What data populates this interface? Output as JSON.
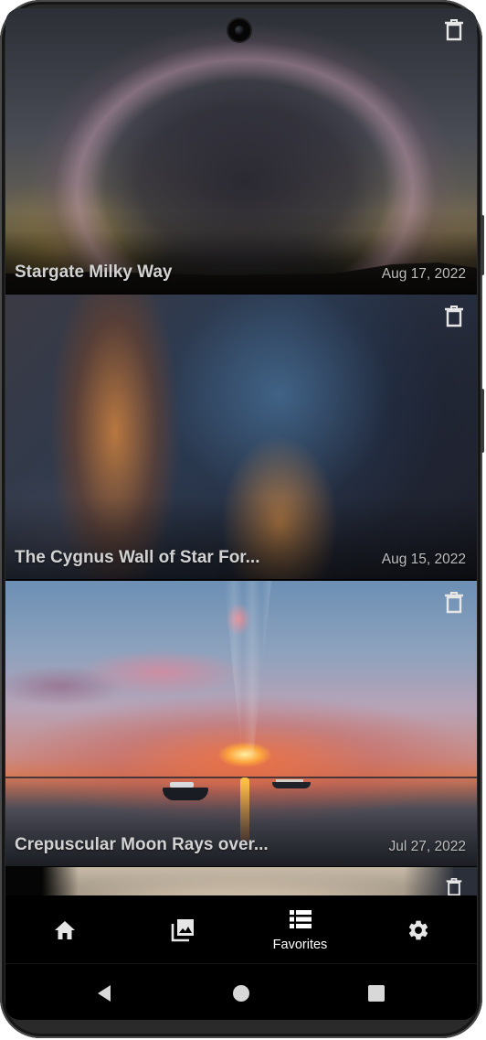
{
  "cards": [
    {
      "title": "Stargate Milky Way",
      "date": "Aug 17, 2022",
      "image": "milky-way-arch-photo"
    },
    {
      "title": "The Cygnus Wall of Star For...",
      "date": "Aug 15, 2022",
      "image": "cygnus-wall-nebula-photo"
    },
    {
      "title": "Crepuscular Moon Rays over...",
      "date": "Jul 27, 2022",
      "image": "moon-rays-sea-boats-photo"
    },
    {
      "title": "",
      "date": "",
      "image": "partial-card-photo"
    }
  ],
  "bottom_nav": {
    "items": [
      {
        "icon": "home-icon",
        "label": ""
      },
      {
        "icon": "gallery-icon",
        "label": ""
      },
      {
        "icon": "favorites-list-icon",
        "label": "Favorites",
        "selected": true
      },
      {
        "icon": "settings-gear-icon",
        "label": ""
      }
    ]
  },
  "system_nav": [
    "back-icon",
    "home-circle-icon",
    "recents-square-icon"
  ],
  "colors": {
    "background": "#000000",
    "text": "#ffffff",
    "title_text": "#d2d2d2",
    "date_text": "#bdbdbd"
  }
}
